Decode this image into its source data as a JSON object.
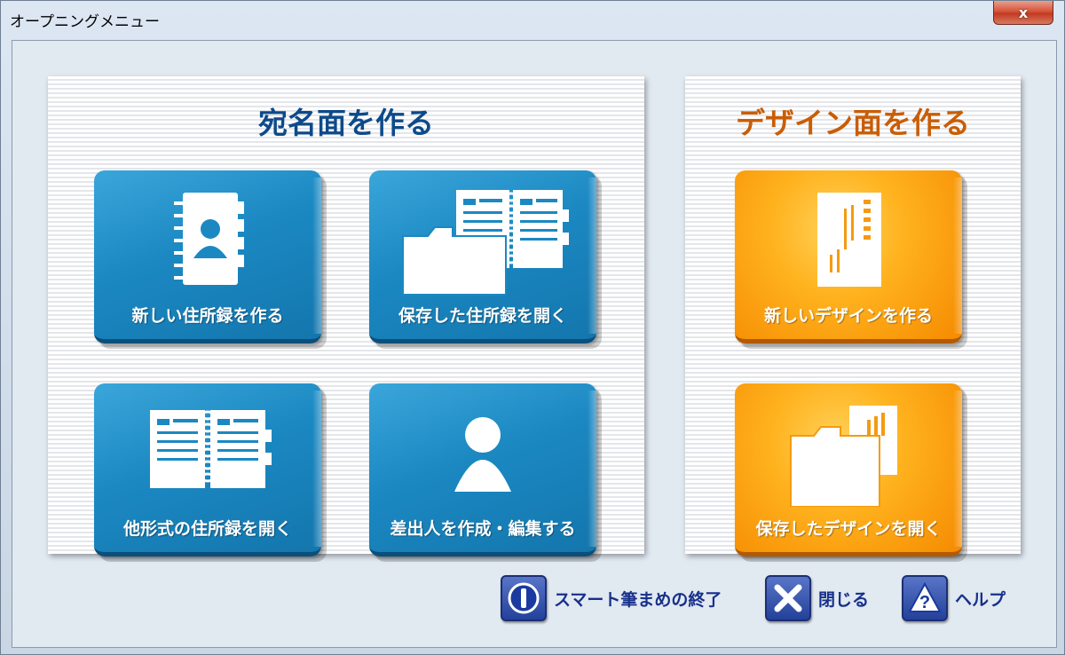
{
  "window": {
    "title": "オープニングメニュー",
    "close_label": "x"
  },
  "panels": {
    "address": {
      "title": "宛名面を作る",
      "buttons": [
        {
          "label": "新しい住所録を作る",
          "icon": "address-book-icon"
        },
        {
          "label": "保存した住所録を開く",
          "icon": "open-folder-address-book-icon"
        },
        {
          "label": "他形式の住所録を開く",
          "icon": "open-book-icon"
        },
        {
          "label": "差出人を作成・編集する",
          "icon": "person-icon"
        }
      ]
    },
    "design": {
      "title": "デザイン面を作る",
      "buttons": [
        {
          "label": "新しいデザインを作る",
          "icon": "postcard-icon"
        },
        {
          "label": "保存したデザインを開く",
          "icon": "folder-postcard-icon"
        }
      ]
    }
  },
  "footer": {
    "exit_label": "スマート筆まめの終了",
    "close_label": "閉じる",
    "help_label": "ヘルプ"
  },
  "colors": {
    "address_title": "#0c4a8a",
    "design_title": "#c95d06",
    "blue_tile": "#1b88c2",
    "orange_tile": "#ffb21e",
    "footer_text": "#17308a"
  }
}
